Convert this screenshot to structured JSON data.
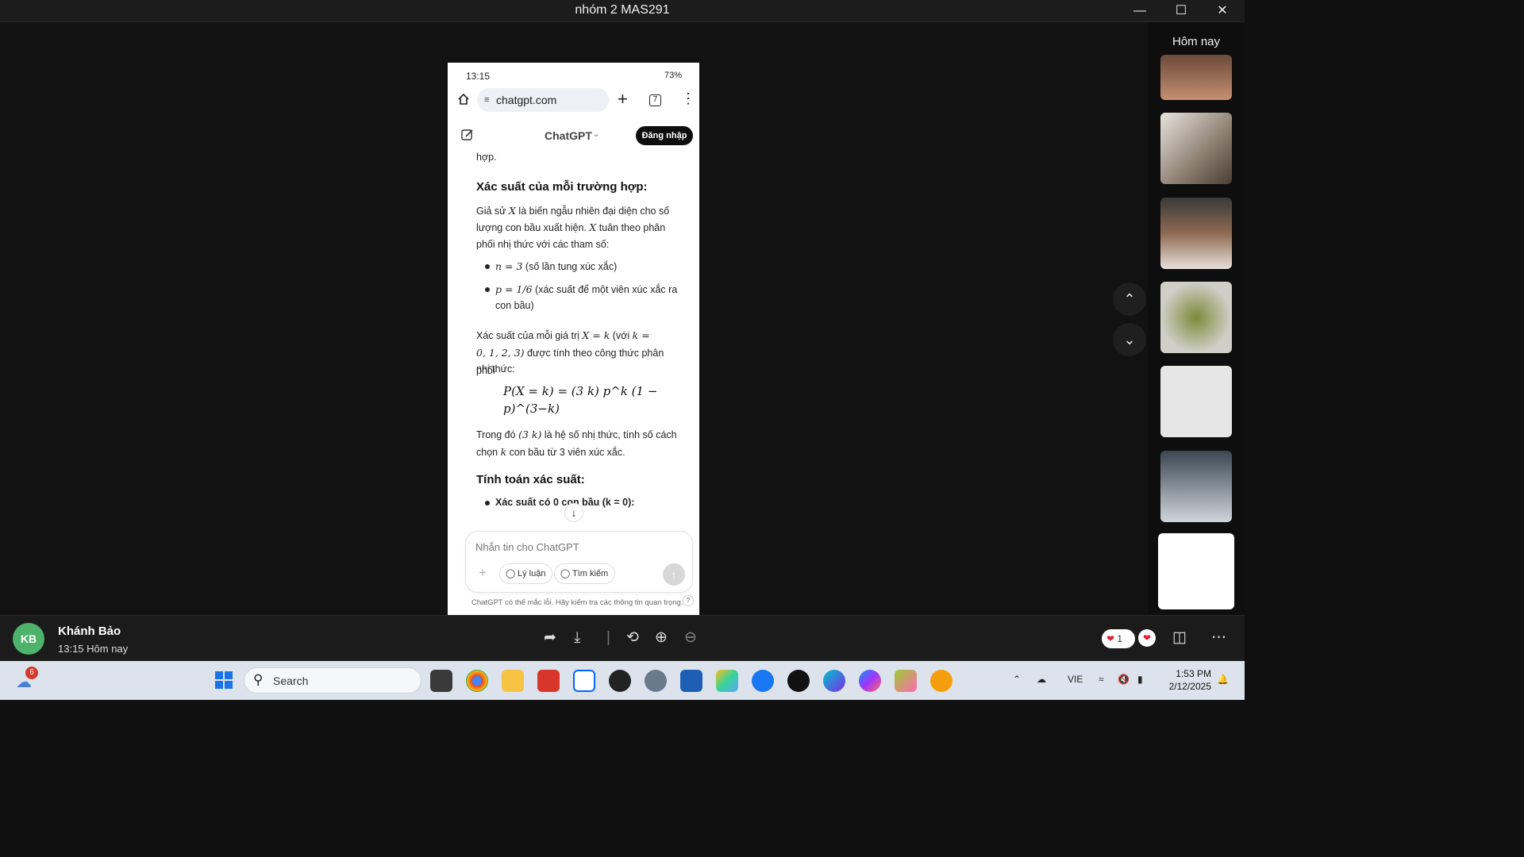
{
  "window": {
    "title": "nhóm 2 MAS291"
  },
  "phone": {
    "status_time": "13:15",
    "battery": "73%",
    "url": "chatgpt.com",
    "tab_count": "7",
    "app_name": "ChatGPT",
    "login_label": "Đăng nhập",
    "content": {
      "line0": "hợp.",
      "h_case": "Xác suất của mỗi trường hợp:",
      "p1_a": "Giả sử",
      "p1_b": "là biến ngẫu nhiên đại diện cho số",
      "p1_c": "lượng con bầu xuất hiện.",
      "p1_d": "tuân theo phân",
      "p1_e": "phối nhị thức với các tham số:",
      "var_x": "X",
      "b1_math": "n = 3",
      "b1_text": "(số lần tung xúc xắc)",
      "b2_math": "p = 1/6",
      "b2_text": "(xác suất để một viên xúc xắc ra",
      "b2_text2": "con bầu)",
      "p2_a": "Xác suất của mỗi giá trị",
      "p2_math1": "X = k",
      "p2_b": "(với",
      "p2_math2": "k =",
      "p2_math3": "0, 1, 2, 3)",
      "p2_c": "được tính theo công thức phân phối",
      "p2_d": "nhị thức:",
      "formula": "P(X = k) = (3 k) p^k (1 − p)^(3−k)",
      "p3_a": "Trong đó",
      "p3_math": "(3 k)",
      "p3_b": "là hệ số nhị thức, tính số cách",
      "p3_c": "chọn",
      "p3_math2": "k",
      "p3_d": "con bầu từ 3 viên xúc xắc.",
      "h_calc": "Tính toán xác suất:",
      "b3_text": "Xác suất có 0 con bầu (k = 0):"
    },
    "composer": {
      "placeholder": "Nhắn tin cho ChatGPT",
      "reason_label": "Lý luận",
      "search_label": "Tìm kiếm"
    },
    "disclaimer": "ChatGPT có thể mắc lỗi. Hãy kiểm tra các thông tin quan trọng."
  },
  "panel": {
    "header": "Hôm nay"
  },
  "info": {
    "avatar_initials": "KB",
    "sender": "Khánh Bảo",
    "time": "13:15 Hôm nay",
    "reaction_count": "1"
  },
  "taskbar": {
    "search_label": "Search",
    "weather_badge": "6",
    "lang": "VIE",
    "time": "1:53 PM",
    "date": "2/12/2025"
  },
  "icons": {
    "home": "home-icon",
    "share": "forward-icon",
    "download": "download-icon",
    "rotate": "rotate-icon",
    "zoom_in": "zoom-in-icon",
    "zoom_out": "zoom-out-icon"
  },
  "colors": {
    "avatar": "#4db36b",
    "send_disabled": "#d7d7d7",
    "login_bg": "#0d0d0d"
  }
}
